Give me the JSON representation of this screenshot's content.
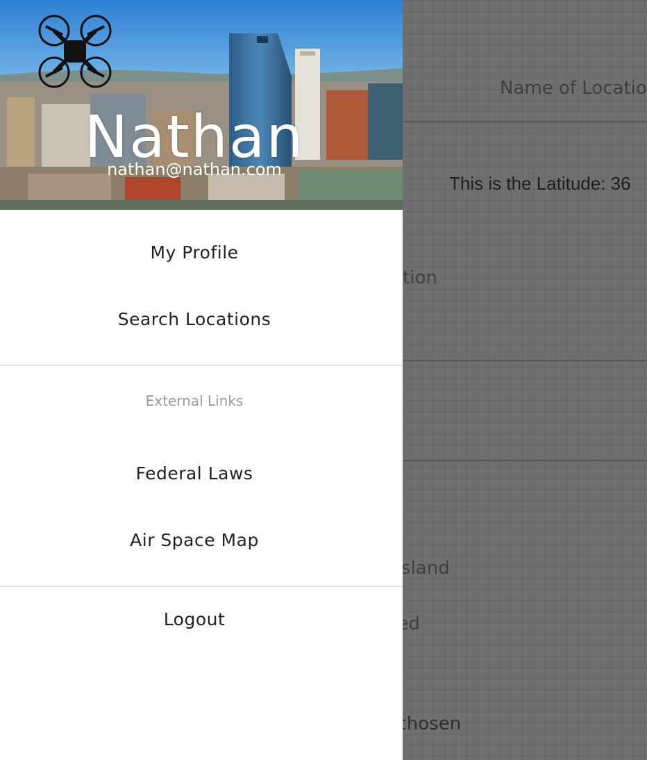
{
  "background": {
    "name_of_location": "Name of Locatio",
    "latitude_text": "This is the Latitude: 36",
    "location_label": "Location",
    "grassland_label": "Open Grassland",
    "wooded_label": "Wooded",
    "file_status": "No file chosen"
  },
  "drawer": {
    "header": {
      "user_name": "Nathan",
      "user_email": "nathan@nathan.com",
      "logo_icon": "drone-icon"
    },
    "menu": {
      "my_profile": "My Profile",
      "search_locations": "Search Locations",
      "external_links_header": "External Links",
      "federal_laws": "Federal Laws",
      "air_space_map": "Air Space Map",
      "logout": "Logout"
    }
  },
  "colors": {
    "drawer_bg": "#ffffff",
    "overlay": "#6f6f6f",
    "sky": "#3b8fd8",
    "subheader": "#9a9a9a"
  }
}
